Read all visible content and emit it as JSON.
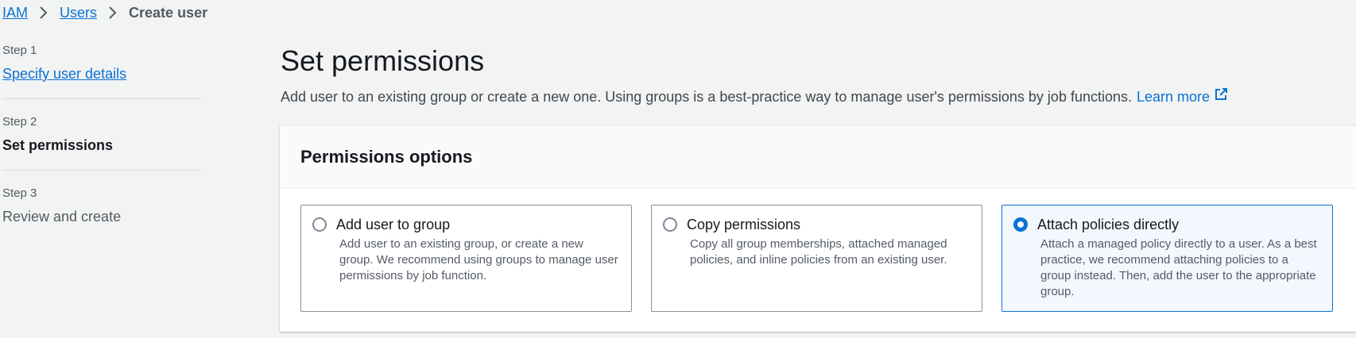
{
  "breadcrumb": {
    "items": [
      "IAM",
      "Users"
    ],
    "current": "Create user"
  },
  "steps": [
    {
      "number": "Step 1",
      "label": "Specify user details",
      "state": "link"
    },
    {
      "number": "Step 2",
      "label": "Set permissions",
      "state": "current"
    },
    {
      "number": "Step 3",
      "label": "Review and create",
      "state": "disabled"
    }
  ],
  "page": {
    "title": "Set permissions",
    "description": "Add user to an existing group or create a new one. Using groups is a best-practice way to manage user's permissions by job functions.",
    "learn_more": "Learn more"
  },
  "permissions": {
    "title": "Permissions options",
    "options": [
      {
        "title": "Add user to group",
        "description": "Add user to an existing group, or create a new group. We recommend using groups to manage user permissions by job function.",
        "selected": false
      },
      {
        "title": "Copy permissions",
        "description": "Copy all group memberships, attached managed policies, and inline policies from an existing user.",
        "selected": false
      },
      {
        "title": "Attach policies directly",
        "description": "Attach a managed policy directly to a user. As a best practice, we recommend attaching policies to a group instead. Then, add the user to the appropriate group.",
        "selected": true
      }
    ]
  },
  "colors": {
    "link": "#0972d3",
    "selected_bg": "#f2f8fd",
    "page_bg": "#f2f3f3"
  }
}
